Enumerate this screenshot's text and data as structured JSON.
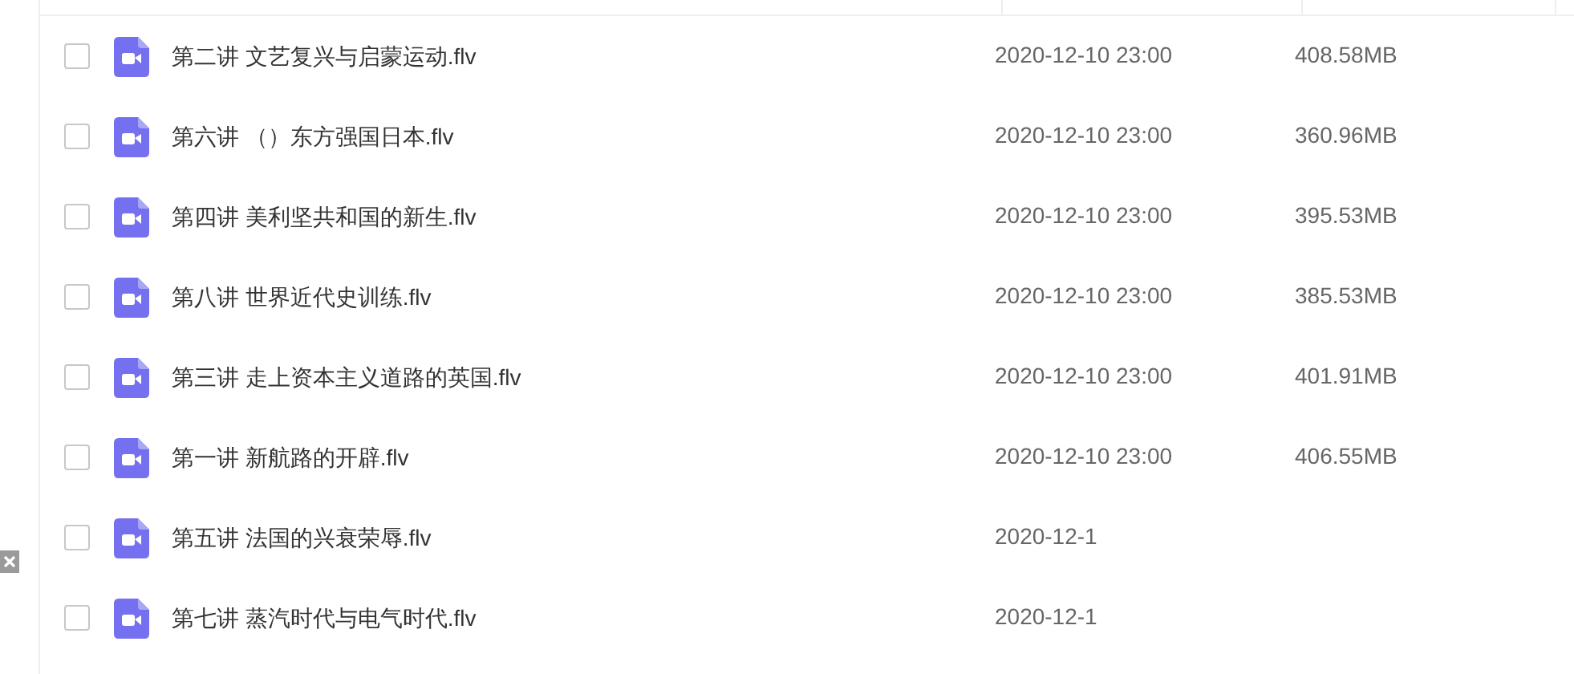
{
  "files": [
    {
      "name": "第二讲 文艺复兴与启蒙运动.flv",
      "modified": "2020-12-10 23:00",
      "size": "408.58MB",
      "checked": false
    },
    {
      "name": "第六讲 （）东方强国日本.flv",
      "modified": "2020-12-10 23:00",
      "size": "360.96MB",
      "checked": false
    },
    {
      "name": "第四讲 美利坚共和国的新生.flv",
      "modified": "2020-12-10 23:00",
      "size": "395.53MB",
      "checked": false
    },
    {
      "name": "第八讲 世界近代史训练.flv",
      "modified": "2020-12-10 23:00",
      "size": "385.53MB",
      "checked": false
    },
    {
      "name": "第三讲 走上资本主义道路的英国.flv",
      "modified": "2020-12-10 23:00",
      "size": "401.91MB",
      "checked": false
    },
    {
      "name": "第一讲 新航路的开辟.flv",
      "modified": "2020-12-10 23:00",
      "size": "406.55MB",
      "checked": false
    },
    {
      "name": "第五讲 法国的兴衰荣辱.flv",
      "modified": "2020-12-1",
      "checked": false
    },
    {
      "name": "第七讲 蒸汽时代与电气时代.flv",
      "modified": "2020-12-1",
      "checked": false
    }
  ]
}
